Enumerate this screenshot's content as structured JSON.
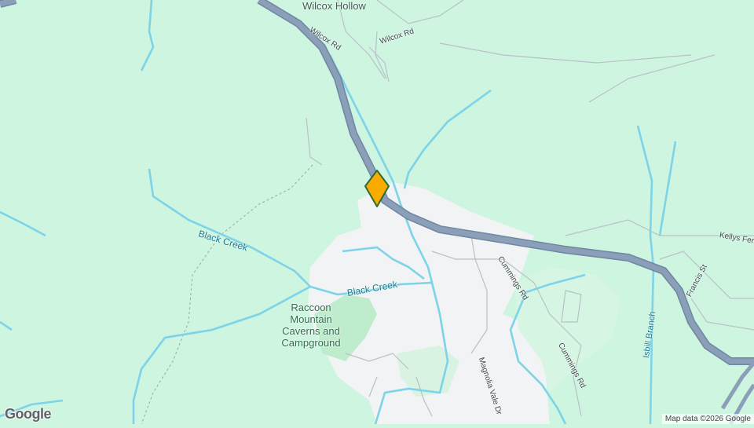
{
  "map": {
    "colors": {
      "land": "#cdf5e0",
      "urban": "#f1f3f4",
      "park": "#bfeccd",
      "highway": "#8b9fb8",
      "highway_edge": "#6f86a3",
      "water": "#7dd3e8",
      "minor_road": "#ffffff",
      "marker_fill": "#f9ab00",
      "marker_stroke": "#2e6b3a"
    },
    "labels": {
      "wilcox_hollow": "Wilcox Hollow",
      "wilcox_rd_1": "Wilcox Rd",
      "wilcox_rd_2": "Wilcox Rd",
      "black_creek_1": "Black Creek",
      "black_creek_2": "Black Creek",
      "raccoon_mountain": "Raccoon Mountain Caverns and Campground",
      "cummings_rd_1": "Cummings Rd",
      "cummings_rd_2": "Cummings Rd",
      "magnolia_vale": "Magnolia Vale Dr",
      "isbill_branch": "Isbill Branch",
      "francis_st": "Francis St",
      "kellys_ferry": "Kellys Fer"
    },
    "marker": {
      "icon": "location-pin-icon"
    },
    "branding": {
      "logo": "Google",
      "attribution": "Map data ©2026 Google"
    }
  }
}
